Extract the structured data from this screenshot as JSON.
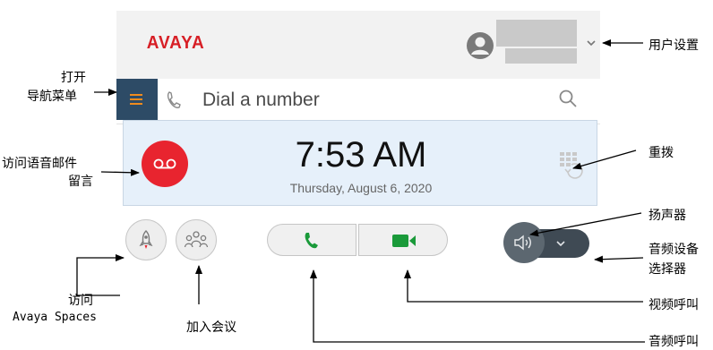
{
  "app": {
    "logo": "AVAYA",
    "dial": {
      "placeholder": "Dial a number"
    },
    "clock": {
      "time": "7:53 AM",
      "date": "Thursday, August 6, 2020"
    }
  },
  "annotations": {
    "user_settings": "用户设置",
    "open_nav_line1": "打开",
    "open_nav_line2": "导航菜单",
    "voicemail_line1": "访问语音邮件",
    "voicemail_line2": "留言",
    "redial": "重拨",
    "speaker": "扬声器",
    "audio_device_line1": "音频设备",
    "audio_device_line2": "选择器",
    "spaces_line1": "访问",
    "spaces_line2": "Avaya Spaces",
    "join_meeting": "加入会议",
    "video_call": "视频呼叫",
    "audio_call": "音频呼叫"
  },
  "colors": {
    "brand_red": "#d71f26",
    "nav_bg": "#2d4b66",
    "nav_accent": "#f08b1d",
    "call_green": "#1a9a3a",
    "voicemail_red": "#e8242f"
  }
}
